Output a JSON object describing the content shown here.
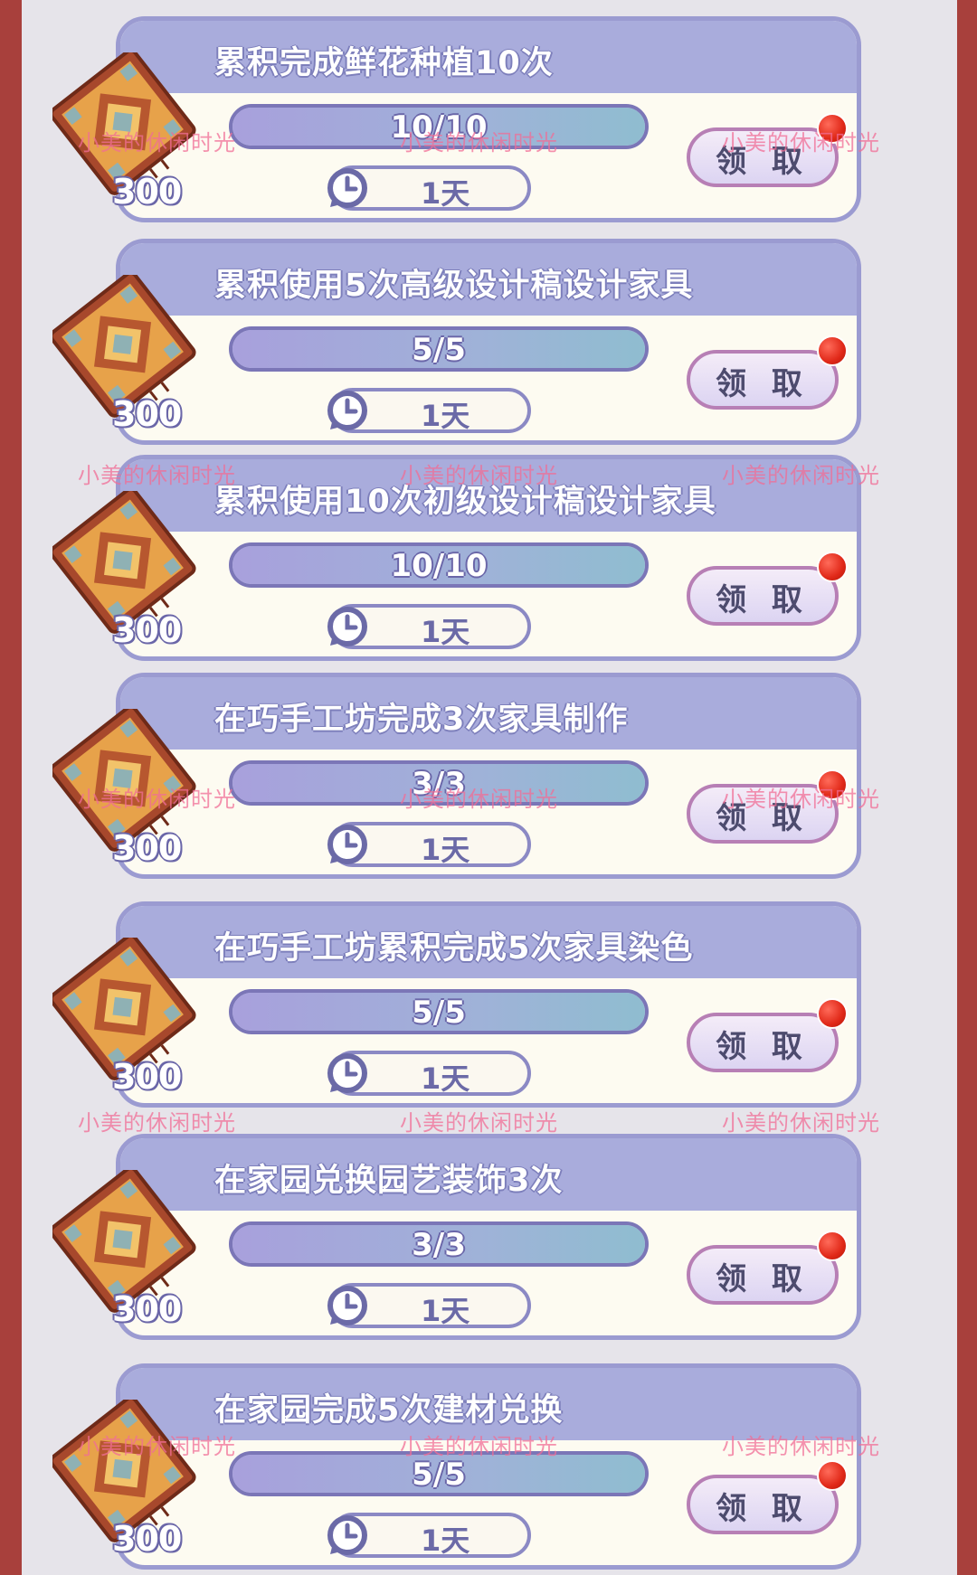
{
  "tasks": [
    {
      "title": "累积完成鲜花种植10次",
      "progress": "10/10",
      "progress_fraction": 1.0,
      "timer": "1天",
      "claim_label": "领 取",
      "reward_count": "300"
    },
    {
      "title": "累积使用5次高级设计稿设计家具",
      "progress": "5/5",
      "progress_fraction": 1.0,
      "timer": "1天",
      "claim_label": "领 取",
      "reward_count": "300"
    },
    {
      "title": "累积使用10次初级设计稿设计家具",
      "progress": "10/10",
      "progress_fraction": 1.0,
      "timer": "1天",
      "claim_label": "领 取",
      "reward_count": "300"
    },
    {
      "title": "在巧手工坊完成3次家具制作",
      "progress": "3/3",
      "progress_fraction": 1.0,
      "timer": "1天",
      "claim_label": "领 取",
      "reward_count": "300"
    },
    {
      "title": "在巧手工坊累积完成5次家具染色",
      "progress": "5/5",
      "progress_fraction": 1.0,
      "timer": "1天",
      "claim_label": "领 取",
      "reward_count": "300"
    },
    {
      "title": "在家园兑换园艺装饰3次",
      "progress": "3/3",
      "progress_fraction": 1.0,
      "timer": "1天",
      "claim_label": "领 取",
      "reward_count": "300"
    },
    {
      "title": "在家园完成5次建材兑换",
      "progress": "5/5",
      "progress_fraction": 1.0,
      "timer": "1天",
      "claim_label": "领 取",
      "reward_count": "300"
    }
  ],
  "watermark": "小美的休闲时光",
  "colors": {
    "card_border": "#9b9bd1",
    "card_header": "#a9acdc",
    "card_body": "#fdfbf1",
    "side_frame": "#a8403c",
    "notification_dot": "#e02818"
  },
  "icons": {
    "reward": "patterned-rug-icon",
    "timer": "clock-icon",
    "notification": "red-dot-icon"
  }
}
